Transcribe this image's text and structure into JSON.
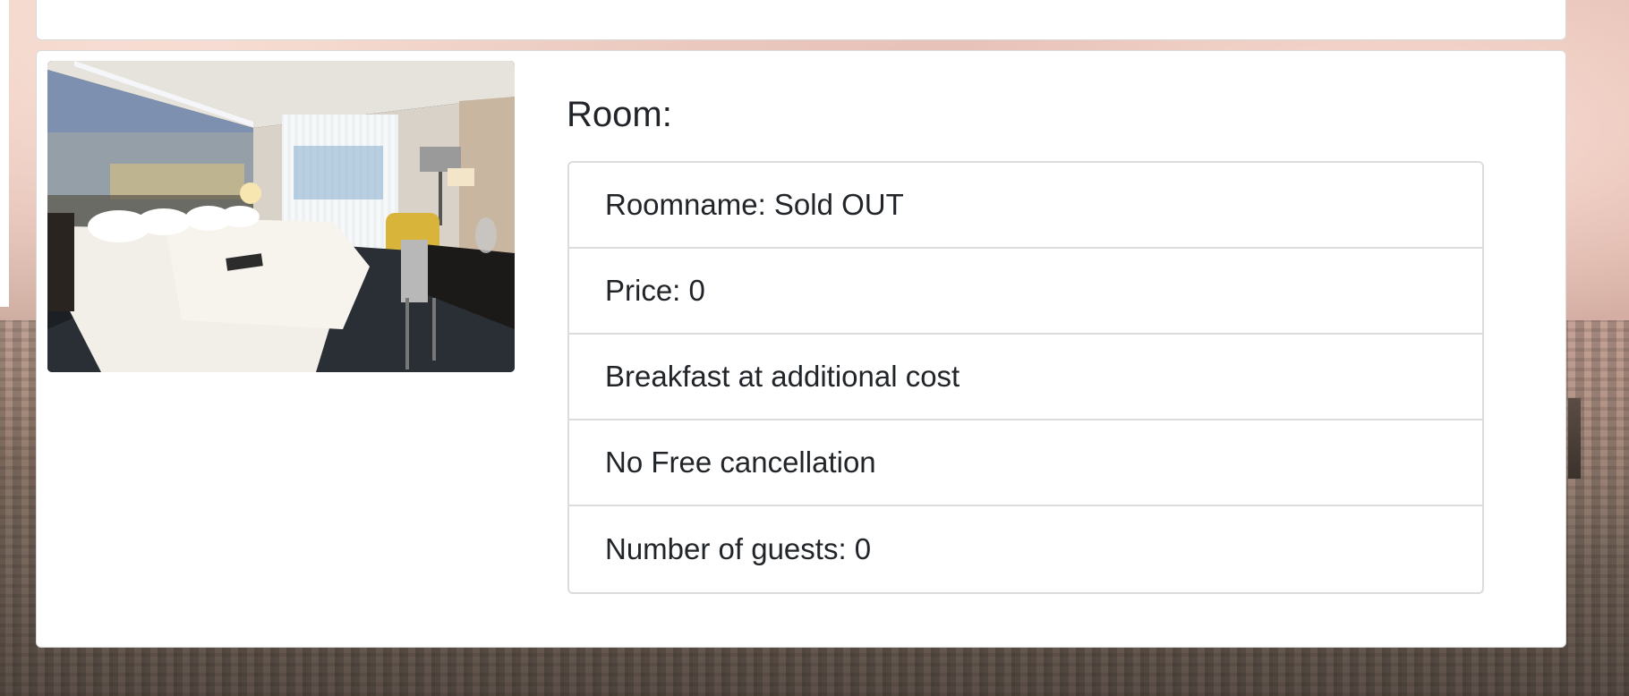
{
  "room": {
    "heading": "Room:",
    "details": [
      {
        "label": "Roomname: Sold OUT"
      },
      {
        "label": "Price: 0"
      },
      {
        "label": "Breakfast at additional cost"
      },
      {
        "label": "No Free cancellation"
      },
      {
        "label": "Number of guests: 0"
      }
    ],
    "photo_icon": "hotel-room-photo"
  },
  "colors": {
    "card_background": "#ffffff",
    "text": "#212529",
    "border": "#dcdcdc"
  }
}
